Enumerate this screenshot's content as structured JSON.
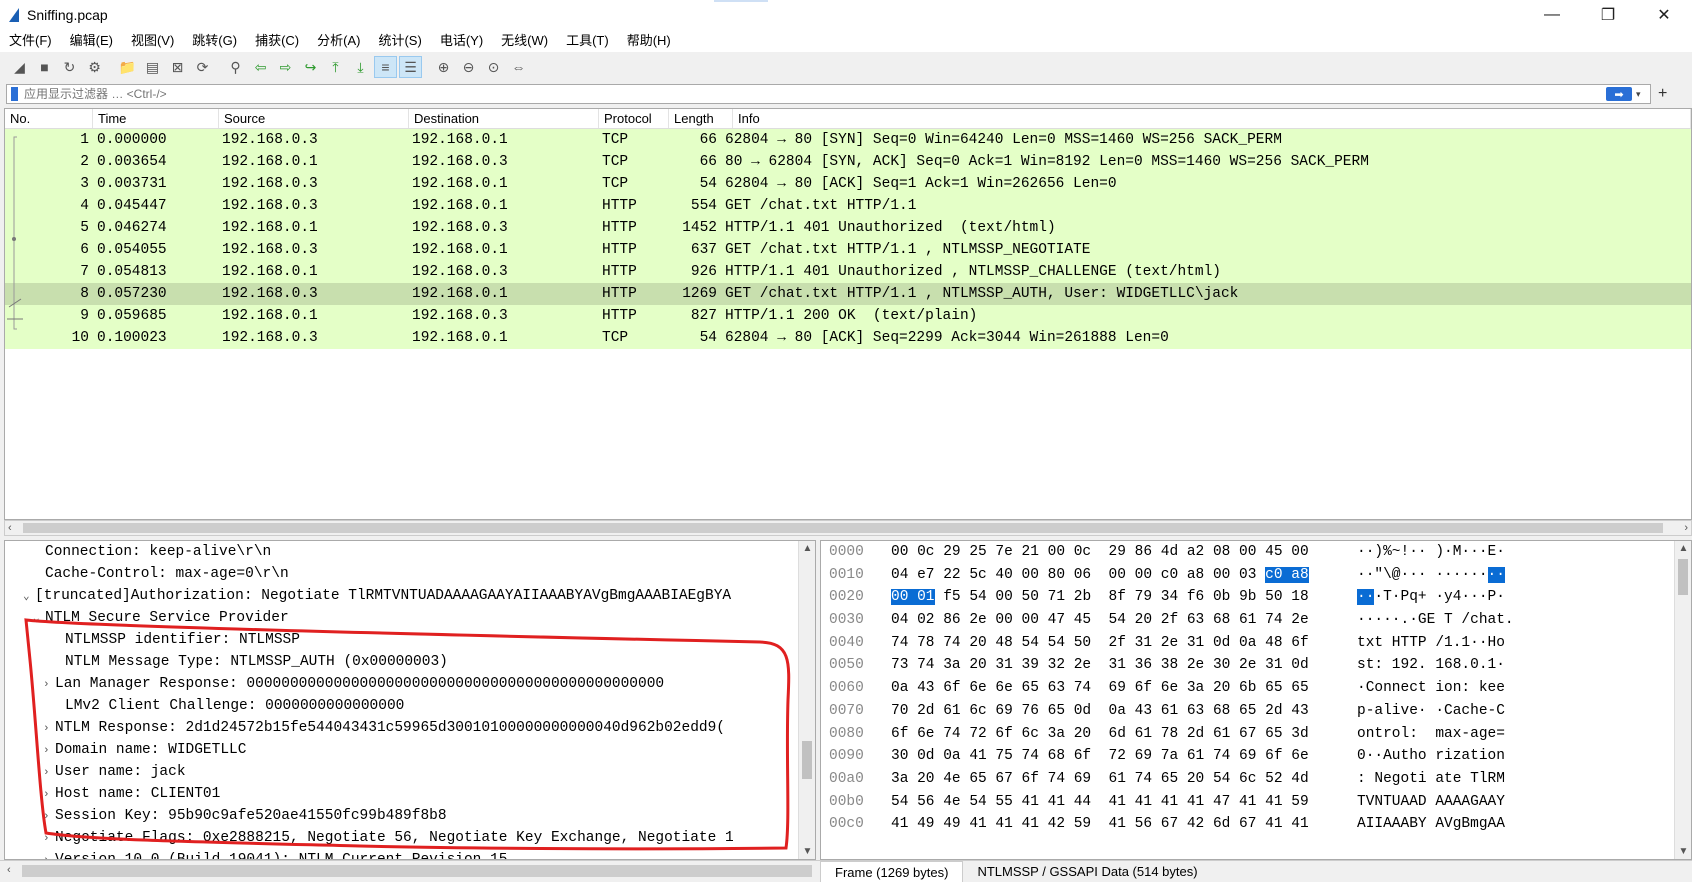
{
  "window": {
    "title": "Sniffing.pcap",
    "minimize": "—",
    "maximize": "❐",
    "close": "✕"
  },
  "menu": [
    "文件(F)",
    "编辑(E)",
    "视图(V)",
    "跳转(G)",
    "捕获(C)",
    "分析(A)",
    "统计(S)",
    "电话(Y)",
    "无线(W)",
    "工具(T)",
    "帮助(H)"
  ],
  "toolbar_icons": [
    "shark-fin-start-icon",
    "stop-icon",
    "restart-icon",
    "capture-options-icon",
    "sep",
    "open-file-icon",
    "save-file-icon",
    "close-file-icon",
    "reload-icon",
    "sep",
    "find-packet-icon",
    "go-back-icon",
    "go-forward-icon",
    "go-to-packet-icon",
    "go-first-icon",
    "go-last-icon",
    "autoscroll-icon",
    "colorize-icon",
    "sep",
    "zoom-in-icon",
    "zoom-out-icon",
    "zoom-normal-icon",
    "resize-columns-icon"
  ],
  "filter": {
    "placeholder": "应用显示过滤器 … <Ctrl-/>",
    "value": ""
  },
  "packet_list": {
    "columns": [
      "No.",
      "Time",
      "Source",
      "Destination",
      "Protocol",
      "Length",
      "Info"
    ],
    "rows": [
      {
        "no": "1",
        "time": "0.000000",
        "src": "192.168.0.3",
        "dst": "192.168.0.1",
        "proto": "TCP",
        "len": "66",
        "info": "62804 → 80 [SYN] Seq=0 Win=64240 Len=0 MSS=1460 WS=256 SACK_PERM"
      },
      {
        "no": "2",
        "time": "0.003654",
        "src": "192.168.0.1",
        "dst": "192.168.0.3",
        "proto": "TCP",
        "len": "66",
        "info": "80 → 62804 [SYN, ACK] Seq=0 Ack=1 Win=8192 Len=0 MSS=1460 WS=256 SACK_PERM"
      },
      {
        "no": "3",
        "time": "0.003731",
        "src": "192.168.0.3",
        "dst": "192.168.0.1",
        "proto": "TCP",
        "len": "54",
        "info": "62804 → 80 [ACK] Seq=1 Ack=1 Win=262656 Len=0"
      },
      {
        "no": "4",
        "time": "0.045447",
        "src": "192.168.0.3",
        "dst": "192.168.0.1",
        "proto": "HTTP",
        "len": "554",
        "info": "GET /chat.txt HTTP/1.1"
      },
      {
        "no": "5",
        "time": "0.046274",
        "src": "192.168.0.1",
        "dst": "192.168.0.3",
        "proto": "HTTP",
        "len": "1452",
        "info": "HTTP/1.1 401 Unauthorized  (text/html)"
      },
      {
        "no": "6",
        "time": "0.054055",
        "src": "192.168.0.3",
        "dst": "192.168.0.1",
        "proto": "HTTP",
        "len": "637",
        "info": "GET /chat.txt HTTP/1.1 , NTLMSSP_NEGOTIATE"
      },
      {
        "no": "7",
        "time": "0.054813",
        "src": "192.168.0.1",
        "dst": "192.168.0.3",
        "proto": "HTTP",
        "len": "926",
        "info": "HTTP/1.1 401 Unauthorized , NTLMSSP_CHALLENGE (text/html)"
      },
      {
        "no": "8",
        "time": "0.057230",
        "src": "192.168.0.3",
        "dst": "192.168.0.1",
        "proto": "HTTP",
        "len": "1269",
        "info": "GET /chat.txt HTTP/1.1 , NTLMSSP_AUTH, User: WIDGETLLC\\jack"
      },
      {
        "no": "9",
        "time": "0.059685",
        "src": "192.168.0.1",
        "dst": "192.168.0.3",
        "proto": "HTTP",
        "len": "827",
        "info": "HTTP/1.1 200 OK  (text/plain)"
      },
      {
        "no": "10",
        "time": "0.100023",
        "src": "192.168.0.3",
        "dst": "192.168.0.1",
        "proto": "TCP",
        "len": "54",
        "info": "62804 → 80 [ACK] Seq=2299 Ack=3044 Win=261888 Len=0"
      }
    ],
    "selected_row": "8"
  },
  "detail_lines": [
    {
      "indent": 2,
      "exp": "",
      "text": "Connection: keep-alive\\r\\n"
    },
    {
      "indent": 2,
      "exp": "",
      "text": "Cache-Control: max-age=0\\r\\n"
    },
    {
      "indent": 1,
      "exp": "⌄",
      "text": "[truncated]Authorization: Negotiate TlRMTVNTUADAAAAGAAYAIIAAABYAVgBmgAAABIAEgBYA"
    },
    {
      "indent": 2,
      "exp": "⌄",
      "text": "NTLM Secure Service Provider"
    },
    {
      "indent": 4,
      "exp": "",
      "text": "NTLMSSP identifier: NTLMSSP"
    },
    {
      "indent": 4,
      "exp": "",
      "text": "NTLM Message Type: NTLMSSP_AUTH (0x00000003)"
    },
    {
      "indent": 3,
      "exp": "›",
      "text": "Lan Manager Response: 000000000000000000000000000000000000000000000000"
    },
    {
      "indent": 4,
      "exp": "",
      "text": "LMv2 Client Challenge: 0000000000000000"
    },
    {
      "indent": 3,
      "exp": "›",
      "text": "NTLM Response: 2d1d24572b15fe544043431c59965d30010100000000000040d962b02edd9("
    },
    {
      "indent": 3,
      "exp": "›",
      "text": "Domain name: WIDGETLLC"
    },
    {
      "indent": 3,
      "exp": "›",
      "text": "User name: jack"
    },
    {
      "indent": 3,
      "exp": "›",
      "text": "Host name: CLIENT01"
    },
    {
      "indent": 3,
      "exp": "›",
      "text": "Session Key: 95b90c9afe520ae41550fc99b489f8b8"
    },
    {
      "indent": 3,
      "exp": "›",
      "text": "Negotiate Flags: 0xe2888215, Negotiate 56, Negotiate Key Exchange, Negotiate 1"
    },
    {
      "indent": 3,
      "exp": "›",
      "text": "Version 10.0 (Build 19041); NTLM Current Revision 15"
    }
  ],
  "hex_lines": [
    {
      "off": "0000",
      "bytes": "00 0c 29 25 7e 21 00 0c  29 86 4d a2 08 00 45 00",
      "ascii": "··)%~!·· )·M···E·"
    },
    {
      "off": "0010",
      "bytes": "04 e7 22 5c 40 00 80 06  00 00 c0 a8 00 03 ",
      "hb": "c0 a8",
      "ascii": "··\"\\@··· ······",
      "ha": "··"
    },
    {
      "off": "0020",
      "hb0": "00 01",
      "bytes": " f5 54 00 50 71 2b  8f 79 34 f6 0b 9b 50 18",
      "ha0": "··",
      "ascii": "·T·Pq+ ·y4···P·"
    },
    {
      "off": "0030",
      "bytes": "04 02 86 2e 00 00 47 45  54 20 2f 63 68 61 74 2e",
      "ascii": "·····.·GE T /chat."
    },
    {
      "off": "0040",
      "bytes": "74 78 74 20 48 54 54 50  2f 31 2e 31 0d 0a 48 6f",
      "ascii": "txt HTTP /1.1··Ho"
    },
    {
      "off": "0050",
      "bytes": "73 74 3a 20 31 39 32 2e  31 36 38 2e 30 2e 31 0d",
      "ascii": "st: 192. 168.0.1·"
    },
    {
      "off": "0060",
      "bytes": "0a 43 6f 6e 6e 65 63 74  69 6f 6e 3a 20 6b 65 65",
      "ascii": "·Connect ion: kee"
    },
    {
      "off": "0070",
      "bytes": "70 2d 61 6c 69 76 65 0d  0a 43 61 63 68 65 2d 43",
      "ascii": "p-alive· ·Cache-C"
    },
    {
      "off": "0080",
      "bytes": "6f 6e 74 72 6f 6c 3a 20  6d 61 78 2d 61 67 65 3d",
      "ascii": "ontrol:  max-age="
    },
    {
      "off": "0090",
      "bytes": "30 0d 0a 41 75 74 68 6f  72 69 7a 61 74 69 6f 6e",
      "ascii": "0··Autho rization"
    },
    {
      "off": "00a0",
      "bytes": "3a 20 4e 65 67 6f 74 69  61 74 65 20 54 6c 52 4d",
      "ascii": ": Negoti ate TlRM"
    },
    {
      "off": "00b0",
      "bytes": "54 56 4e 54 55 41 41 44  41 41 41 41 47 41 41 59",
      "ascii": "TVNTUAAD AAAAGAAY"
    },
    {
      "off": "00c0",
      "bytes": "41 49 49 41 41 41 42 59  41 56 67 42 6d 67 41 41",
      "ascii": "AIIAAABY AVgBmgAA"
    }
  ],
  "bytes_tabs": [
    "Frame (1269 bytes)",
    "NTLMSSP / GSSAPI Data (514 bytes)"
  ],
  "colors": {
    "tcp_http_row": "#e4ffc7",
    "selected_row": "#c8dfae",
    "highlight": "#0a6cd4",
    "annotation": "#e02020"
  }
}
